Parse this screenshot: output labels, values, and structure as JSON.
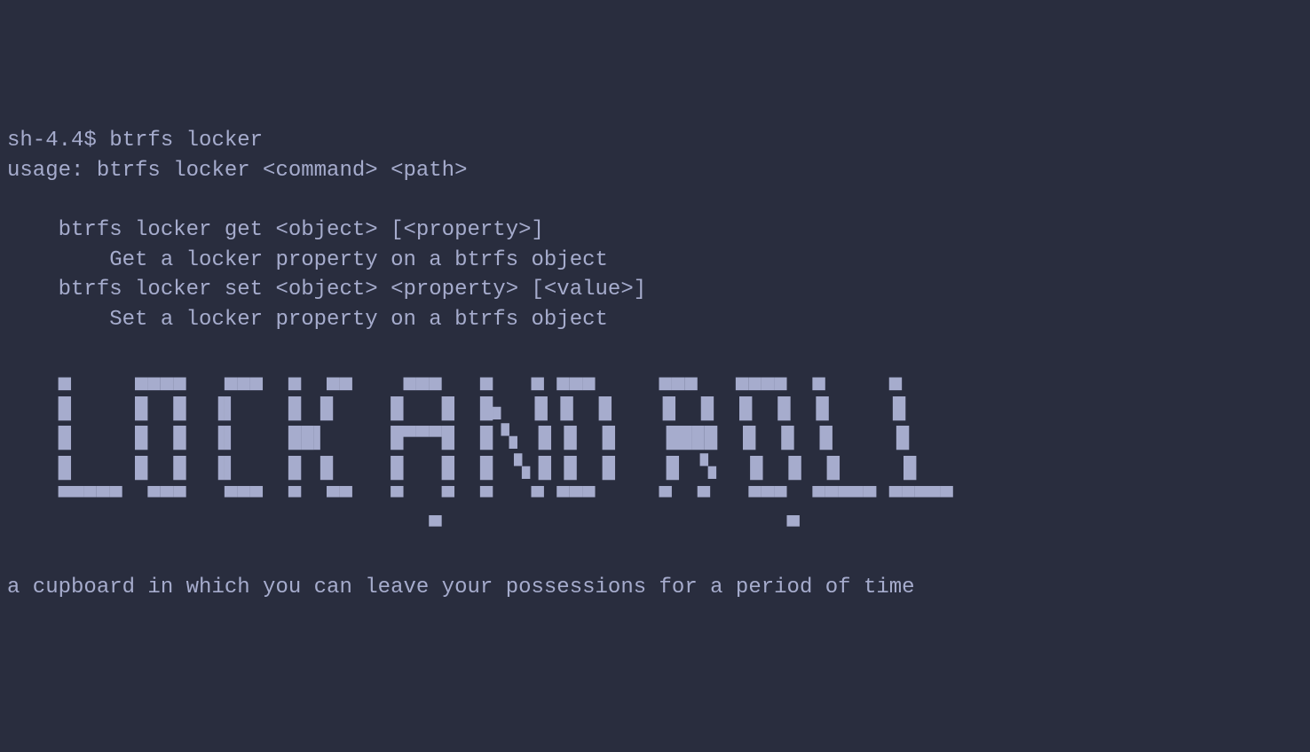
{
  "prompt": "sh-4.4$ ",
  "command": "btrfs locker",
  "usage": "usage: btrfs locker <command> <path>",
  "help": {
    "get_cmd": "    btrfs locker get <object> [<property>]",
    "get_desc": "        Get a locker property on a btrfs object",
    "set_cmd": "    btrfs locker set <object> <property> [<value>]",
    "set_desc": "        Set a locker property on a btrfs object"
  },
  "ascii_art_text": "LOCK AND ROLL",
  "ascii_art": "    ▄     ▄▄▄▄   ▄▄▄  ▄  ▄▄    ▄▄▄   ▄   ▄ ▄▄▄     ▄▄▄   ▄▄▄▄  ▄     ▄    \n    █     █  █  ▐▌    █ ▐▌    █   █  █▖  █ █  █    █  █  █  █  █     █    \n    █     █  █  ▐▌    ██▌     █▀▀▀█  █▝▖ █ █  █    ████  █  █  █     █    \n    █     █  █  ▐▌    █ ▐▌    █   █  █ ▝▖█ █  █    █ ▝▖  █  █  █     █    \n    ▀▀▀▀▀  ▀▀▀   ▀▀▀  ▀  ▀▀   ▀   ▀  ▀   ▀ ▀▀▀     ▀  ▀   ▀▀▀  ▀▀▀▀▀ ▀▀▀▀▀\n                                 ▀                           ▀            ",
  "description": "a cupboard in which you can leave your possessions for a period of time"
}
